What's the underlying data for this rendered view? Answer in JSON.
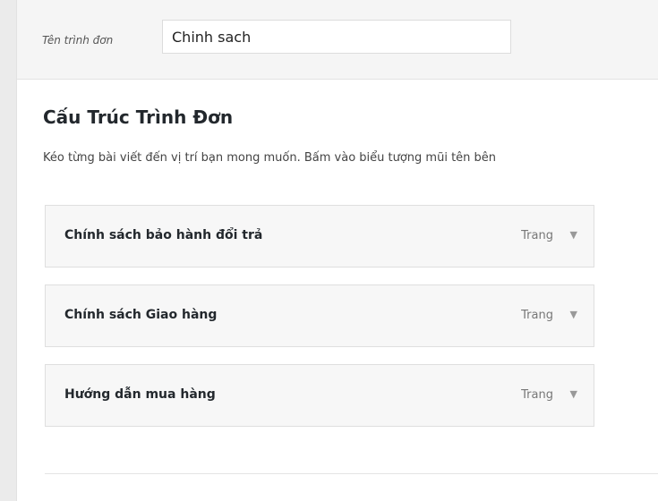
{
  "menu_name": {
    "label": "Tên trình đơn",
    "value": "Chinh sach"
  },
  "structure": {
    "title": "Cấu Trúc Trình Đơn",
    "description": "Kéo từng bài viết đến vị trí bạn mong muốn. Bấm vào biểu tượng mũi tên bên"
  },
  "menu_items": [
    {
      "title": "Chính sách bảo hành đổi trả",
      "type": "Trang"
    },
    {
      "title": "Chính sách Giao hàng",
      "type": "Trang"
    },
    {
      "title": "Hướng dẫn mua hàng",
      "type": "Trang"
    }
  ],
  "icons": {
    "expand": "chevron-down-icon"
  }
}
